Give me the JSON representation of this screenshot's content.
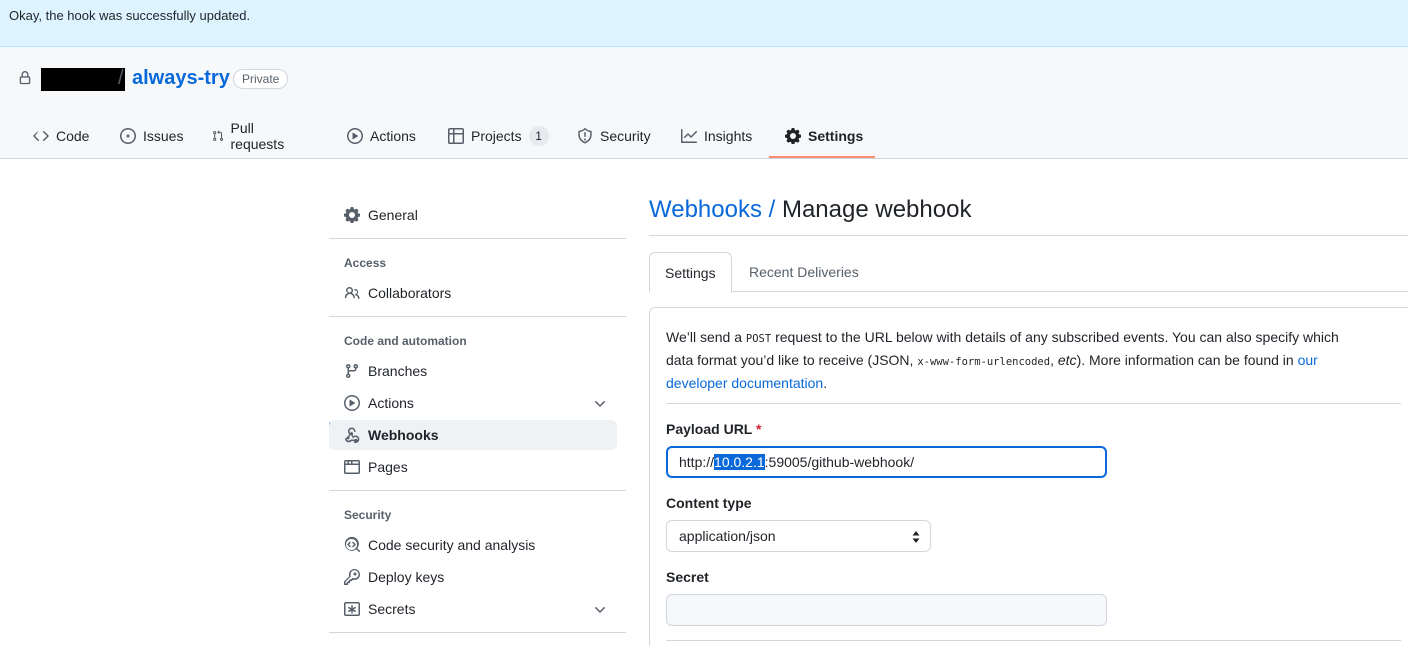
{
  "flash": {
    "message": "Okay, the hook was successfully updated."
  },
  "repo": {
    "separator": "/",
    "name": "always-try",
    "visibility": "Private"
  },
  "tabs": [
    {
      "label": "Code",
      "icon": "code-icon"
    },
    {
      "label": "Issues",
      "icon": "issue-icon"
    },
    {
      "label": "Pull requests",
      "icon": "pull-request-icon"
    },
    {
      "label": "Actions",
      "icon": "play-icon"
    },
    {
      "label": "Projects",
      "icon": "table-icon",
      "counter": "1"
    },
    {
      "label": "Security",
      "icon": "shield-icon"
    },
    {
      "label": "Insights",
      "icon": "graph-icon"
    },
    {
      "label": "Settings",
      "icon": "gear-icon",
      "selected": true
    }
  ],
  "sidebar": {
    "general": "General",
    "sections": [
      {
        "heading": "Access",
        "items": [
          "Collaborators"
        ]
      },
      {
        "heading": "Code and automation",
        "items": [
          "Branches",
          "Actions",
          "Webhooks",
          "Pages"
        ]
      },
      {
        "heading": "Security",
        "items": [
          "Code security and analysis",
          "Deploy keys",
          "Secrets"
        ]
      }
    ],
    "active_item": "Webhooks"
  },
  "main": {
    "breadcrumb_link": "Webhooks /",
    "title": "Manage webhook",
    "subtabs": [
      "Settings",
      "Recent Deliveries"
    ],
    "description": {
      "part1": "We’ll send a ",
      "code1": "POST",
      "part2": " request to the URL below with details of any subscribed events. You can also specify which data format you’d like to receive (JSON, ",
      "code2": "x-www-form-urlencoded",
      "part3": ", ",
      "etc": "etc",
      "part4": "). More information can be found in ",
      "link": "our developer documentation",
      "part5": "."
    },
    "payload_url": {
      "label": "Payload URL",
      "required_mark": "*",
      "prefix": "http://",
      "selected": "10.0.2.1",
      "suffix": ":59005/github-webhook/"
    },
    "content_type": {
      "label": "Content type",
      "value": "application/json"
    },
    "secret": {
      "label": "Secret",
      "value": ""
    }
  },
  "colors": {
    "accent": "#0969da",
    "tab_underline": "#fd8c73",
    "flash_bg": "#ddf4ff"
  }
}
